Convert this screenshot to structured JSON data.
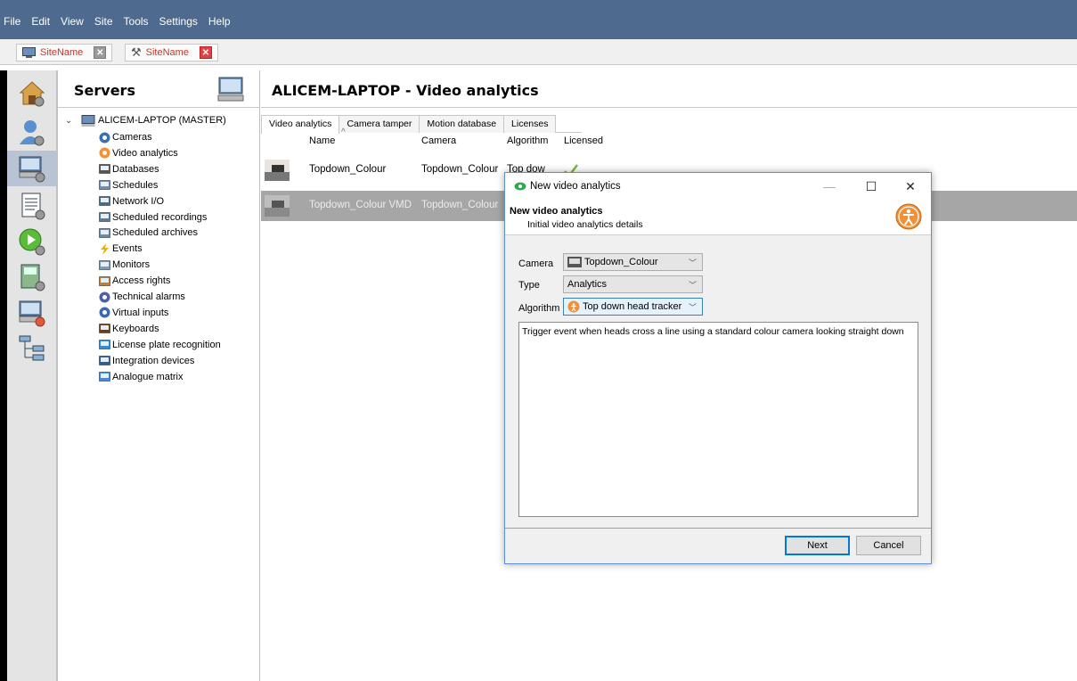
{
  "menu": [
    "File",
    "Edit",
    "View",
    "Site",
    "Tools",
    "Settings",
    "Help"
  ],
  "site_tabs": [
    {
      "label": "SiteName"
    },
    {
      "label": "SiteName"
    }
  ],
  "rail_icons": [
    "home-settings-icon",
    "user-settings-icon",
    "servers-icon",
    "report-icon",
    "play-settings-icon",
    "device-settings-icon",
    "server-alert-icon",
    "network-diagram-icon"
  ],
  "servers": {
    "title": "Servers",
    "root": "ALICEM-LAPTOP (MASTER)",
    "items": [
      {
        "label": "Cameras",
        "icon": "camera-icon"
      },
      {
        "label": "Video analytics",
        "icon": "analytics-person-icon"
      },
      {
        "label": "Databases",
        "icon": "database-icon"
      },
      {
        "label": "Schedules",
        "icon": "calendar-icon"
      },
      {
        "label": "Network I/O",
        "icon": "network-io-icon"
      },
      {
        "label": "Scheduled recordings",
        "icon": "scheduled-recording-icon"
      },
      {
        "label": "Scheduled archives",
        "icon": "scheduled-archive-icon"
      },
      {
        "label": "Events",
        "icon": "lightning-icon"
      },
      {
        "label": "Monitors",
        "icon": "monitor-icon"
      },
      {
        "label": "Access rights",
        "icon": "access-rights-icon"
      },
      {
        "label": "Technical alarms",
        "icon": "wrench-icon"
      },
      {
        "label": "Virtual inputs",
        "icon": "virtual-input-icon"
      },
      {
        "label": "Keyboards",
        "icon": "keyboard-icon"
      },
      {
        "label": "License plate recognition",
        "icon": "license-plate-icon"
      },
      {
        "label": "Integration devices",
        "icon": "integration-icon"
      },
      {
        "label": "Analogue matrix",
        "icon": "matrix-icon"
      }
    ]
  },
  "main": {
    "title": "ALICEM-LAPTOP - Video analytics",
    "tabs": [
      "Video analytics",
      "Camera tamper",
      "Motion database",
      "Licenses"
    ],
    "columns": [
      "Name",
      "Camera",
      "Algorithm",
      "Licensed"
    ],
    "rows": [
      {
        "name": "Topdown_Colour",
        "camera": "Topdown_Colour",
        "algorithm": "Top dow",
        "licensed": "check-icon"
      },
      {
        "name": "Topdown_Colour VMD",
        "camera": "Topdown_Colour",
        "algorithm": "",
        "licensed": ""
      }
    ]
  },
  "dialog": {
    "title": "New video analytics",
    "heading": "New video analytics",
    "subheading": "Initial video analytics details",
    "fields": {
      "camera_label": "Camera",
      "camera_value": "Topdown_Colour",
      "type_label": "Type",
      "type_value": "Analytics",
      "algorithm_label": "Algorithm",
      "algorithm_value": "Top down head tracker"
    },
    "description": "Trigger event when heads cross a line using a standard colour camera looking straight down",
    "next_label": "Next",
    "cancel_label": "Cancel"
  },
  "colors": {
    "menubar": "#4f6a8f",
    "selection": "#a6a6a6",
    "accent": "#0078d7",
    "analytics_orange": "#f0913a"
  }
}
